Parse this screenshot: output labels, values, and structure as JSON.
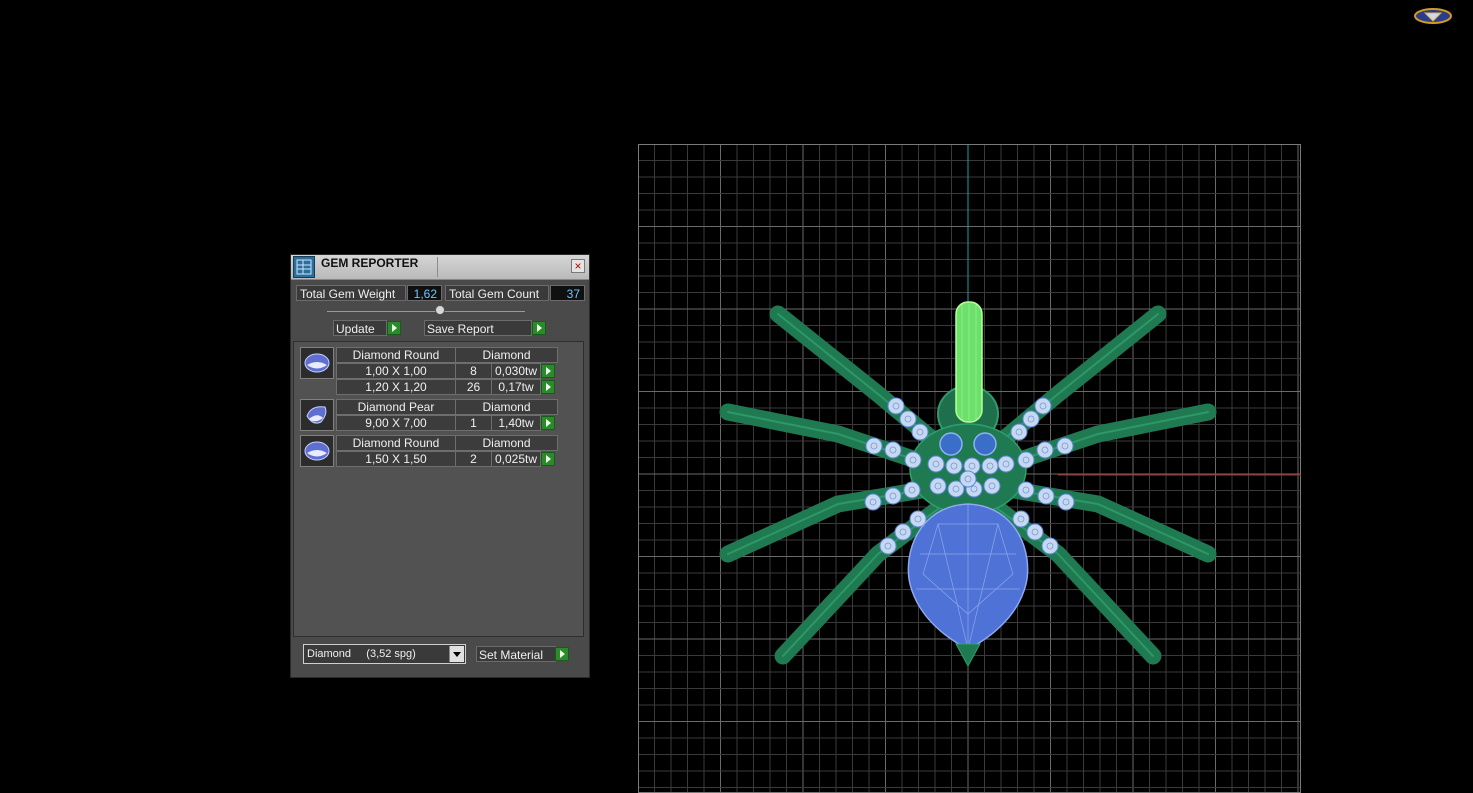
{
  "panel": {
    "title": "GEM REPORTER",
    "total_gem_weight_label": "Total Gem Weight",
    "total_gem_weight_value": "1,62",
    "total_gem_count_label": "Total Gem Count",
    "total_gem_count_value": "37",
    "update_label": "Update",
    "save_report_label": "Save Report",
    "groups": [
      {
        "gem_name": "Diamond Round",
        "material": "Diamond",
        "rows": [
          {
            "size": "1,00 X 1,00",
            "count": "8",
            "weight": "0,030tw"
          },
          {
            "size": "1,20 X 1,20",
            "count": "26",
            "weight": "0,17tw"
          }
        ]
      },
      {
        "gem_name": "Diamond Pear",
        "material": "Diamond",
        "rows": [
          {
            "size": "9,00 X 7,00",
            "count": "1",
            "weight": "1,40tw"
          }
        ]
      },
      {
        "gem_name": "Diamond Round",
        "material": "Diamond",
        "rows": [
          {
            "size": "1,50 X 1,50",
            "count": "2",
            "weight": "0,025tw"
          }
        ]
      }
    ],
    "material_select_value": "Diamond     (3,52 spg)",
    "set_material_label": "Set Material"
  },
  "colors": {
    "panel_bg": "#4a4a4a",
    "metal_green": "#2a8a5c",
    "gem_blue": "#5b7fd8",
    "diamond_white": "#c8d8f0",
    "go_button_green": "#2c8a2c"
  },
  "icons": {
    "logo": "app-logo-icon",
    "title": "gem-reporter-icon",
    "close": "close-icon",
    "go": "play-arrow-icon",
    "round_gem": "round-gem-icon",
    "pear_gem": "pear-gem-icon",
    "dropdown": "chevron-down-icon"
  }
}
